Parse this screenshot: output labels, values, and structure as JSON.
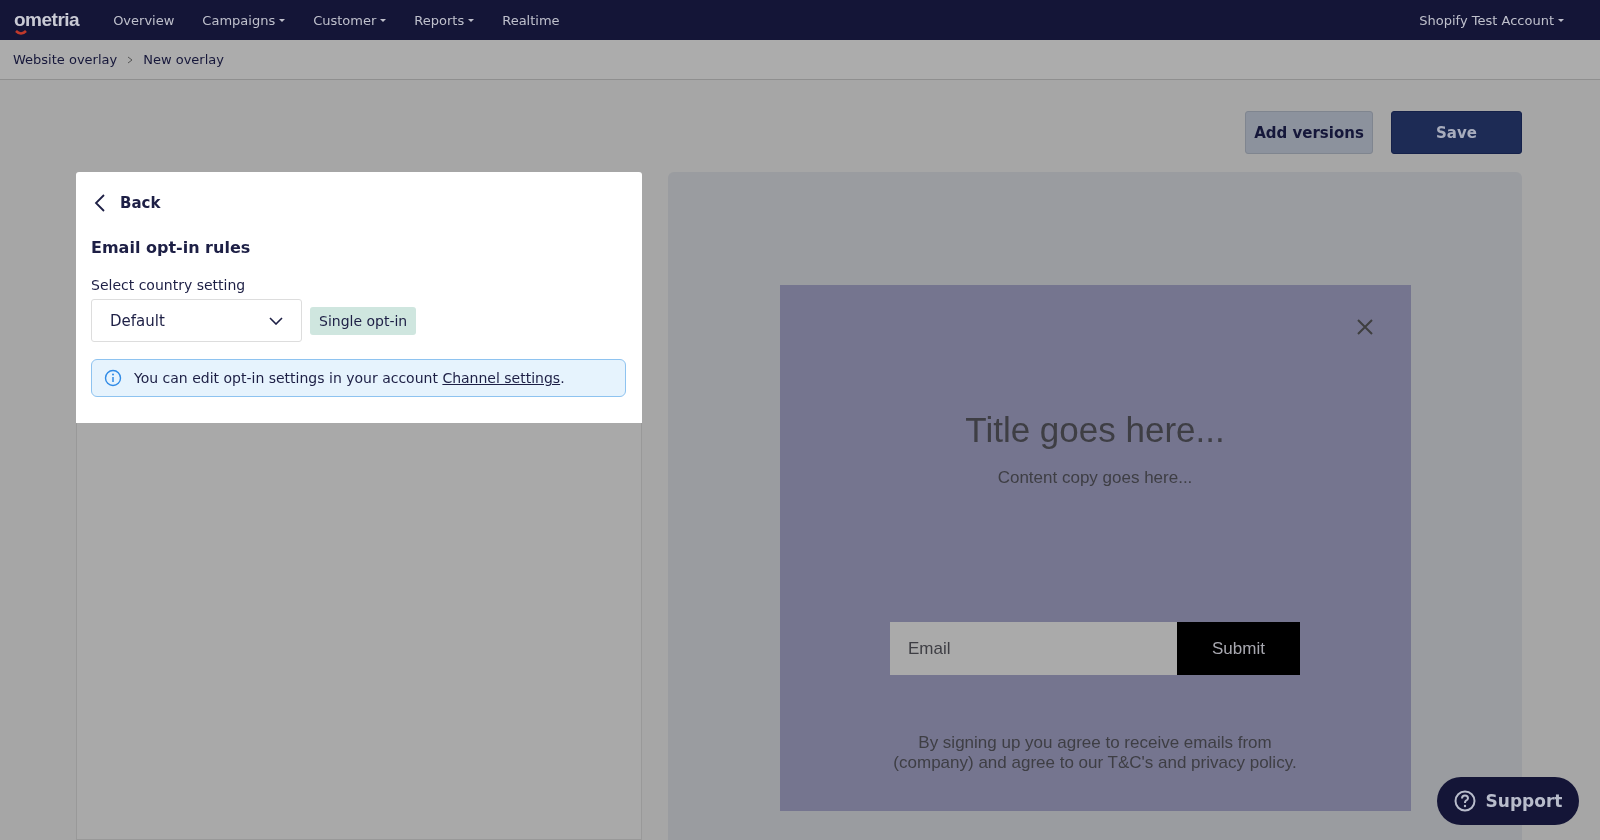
{
  "nav": {
    "logo": "ometria",
    "items": [
      {
        "label": "Overview",
        "dropdown": false
      },
      {
        "label": "Campaigns",
        "dropdown": true
      },
      {
        "label": "Customer",
        "dropdown": true
      },
      {
        "label": "Reports",
        "dropdown": true
      },
      {
        "label": "Realtime",
        "dropdown": false
      }
    ],
    "account": {
      "label": "Shopify Test Account",
      "dropdown": true
    }
  },
  "breadcrumb": [
    "Website overlay",
    "New overlay"
  ],
  "actions": [
    {
      "label": "Add versions",
      "kind": "secondary"
    },
    {
      "label": "Save",
      "kind": "primary"
    }
  ],
  "panel": {
    "back": "Back",
    "heading": "Email opt-in rules",
    "select_label": "Select country setting",
    "select_value": "Default",
    "badge": "Single opt-in",
    "info": {
      "text": "You can edit opt-in settings in your account ",
      "link": "Channel settings",
      "end": "."
    }
  },
  "preview": {
    "title": "Title goes here...",
    "content": "Content copy goes here...",
    "email_placeholder": "Email",
    "submit": "Submit",
    "legal": "By signing up you agree to receive emails from (company) and agree to our T&C's and privacy policy."
  },
  "support": "Support"
}
